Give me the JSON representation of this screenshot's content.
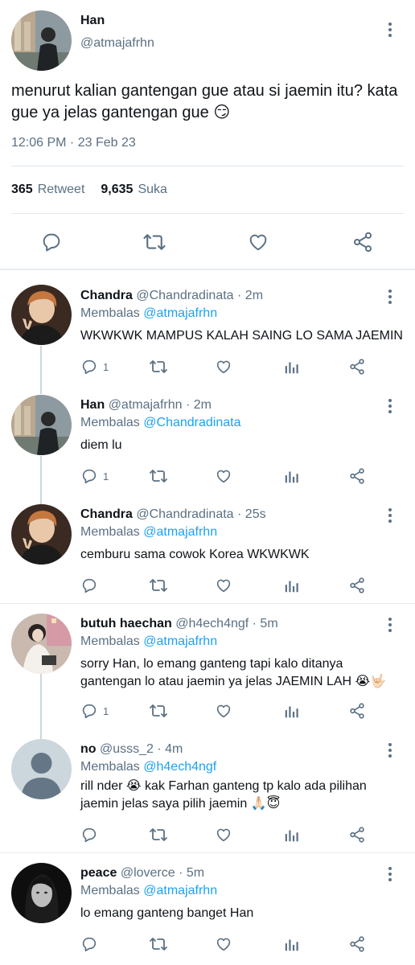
{
  "main_tweet": {
    "name": "Han",
    "handle": "@atmajafrhn",
    "text": "menurut kalian gantengan gue atau si jaemin itu? kata gue ya jelas gantengan gue 😏",
    "time": "12:06 PM · 23 Feb 23",
    "retweets": {
      "count": "365",
      "label": "Retweet"
    },
    "likes": {
      "count": "9,635",
      "label": "Suka"
    }
  },
  "replies": [
    {
      "name": "Chandra",
      "meta": "@Chandradinata · 2m",
      "replying_prefix": "Membalas",
      "replying_to": "@atmajafrhn",
      "text": "WKWKWK MAMPUS KALAH SAING LO SAMA JAEMIN",
      "reply_count": "1"
    },
    {
      "name": "Han",
      "meta": "@atmajafrhn · 2m",
      "replying_prefix": "Membalas",
      "replying_to": "@Chandradinata",
      "text": "diem lu",
      "reply_count": "1"
    },
    {
      "name": "Chandra",
      "meta": "@Chandradinata · 25s",
      "replying_prefix": "Membalas",
      "replying_to": "@atmajafrhn",
      "text": "cemburu sama cowok Korea WKWKWK",
      "reply_count": ""
    },
    {
      "name": "butuh haechan",
      "meta": "@h4ech4ngf · 5m",
      "replying_prefix": "Membalas",
      "replying_to": "@atmajafrhn",
      "text": "sorry Han, lo emang ganteng tapi kalo ditanya gantengan lo atau jaemin ya jelas JAEMIN LAH 😭🤟🏻",
      "reply_count": "1"
    },
    {
      "name": "no",
      "meta": "@usss_2 · 4m",
      "replying_prefix": "Membalas",
      "replying_to": "@h4ech4ngf",
      "text": "rill nder 😭 kak Farhan ganteng tp kalo ada pilihan jaemin jelas saya pilih jaemin 🙏🏻😇",
      "reply_count": ""
    },
    {
      "name": "peace",
      "meta": "@loverce · 5m",
      "replying_prefix": "Membalas",
      "replying_to": "@atmajafrhn",
      "text": "lo emang ganteng banget Han",
      "reply_count": ""
    }
  ],
  "icons": {
    "reply": "comment-bubble-icon",
    "retweet": "retweet-icon",
    "like": "heart-icon",
    "analytics": "bar-chart-icon",
    "share": "share-icon",
    "more": "more-vertical-icon"
  },
  "colors": {
    "link": "#1da1f2",
    "secondary": "#5b7083",
    "text": "#0f1419",
    "divider": "#e1e8ed"
  }
}
